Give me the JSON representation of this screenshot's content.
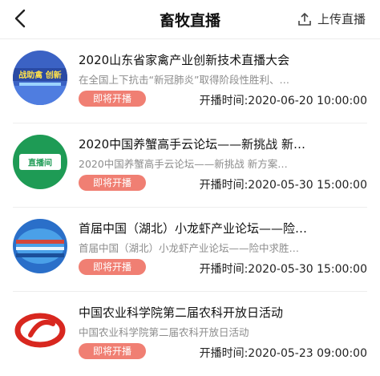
{
  "header": {
    "title": "畜牧直播",
    "upload_label": "上传直播"
  },
  "items": [
    {
      "title": "2020山东省家禽产业创新技术直播大会",
      "description": "在全国上下抗击“新冠肺炎”取得阶段性胜利、…",
      "status": "即将开播",
      "time_label": "开播时间:",
      "time": "2020-06-20 10:00:00",
      "thumb_text": "战助禽 创新"
    },
    {
      "title": "2020中国养蟹高手云论坛——新挑战 新…",
      "description": "2020中国养蟹高手云论坛——新挑战 新方案…",
      "status": "即将开播",
      "time_label": "开播时间:",
      "time": "2020-05-30 15:00:00",
      "thumb_text": "直播间"
    },
    {
      "title": "首届中国（湖北）小龙虾产业论坛——险…",
      "description": "首届中国（湖北）小龙虾产业论坛——险中求胜…",
      "status": "即将开播",
      "time_label": "开播时间:",
      "time": "2020-05-30 15:00:00",
      "thumb_text": ""
    },
    {
      "title": "中国农业科学院第二届农科开放日活动",
      "description": "中国农业科学院第二届农科开放日活动",
      "status": "即将开播",
      "time_label": "开播时间:",
      "time": "2020-05-23 09:00:00",
      "thumb_text": ""
    }
  ]
}
